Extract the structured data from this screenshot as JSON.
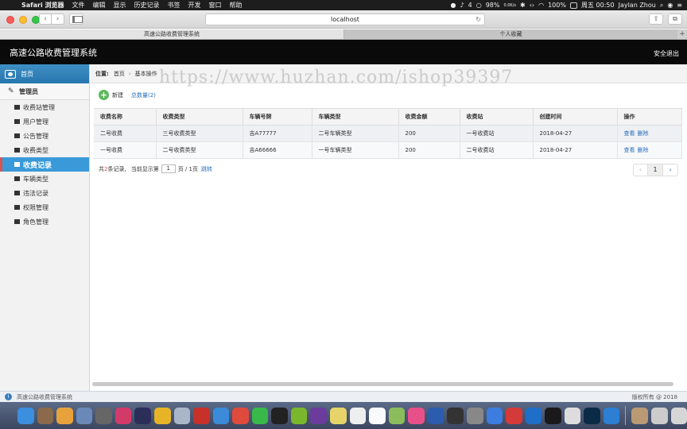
{
  "menubar": {
    "app_name": "Safari 浏览器",
    "items": [
      "文件",
      "编辑",
      "显示",
      "历史记录",
      "书签",
      "开发",
      "窗口",
      "帮助"
    ],
    "battery": "98%",
    "battery_full": "100%",
    "notif_count": "4",
    "net_up": "0.0K/s",
    "net_down": "0.0K/s",
    "clock": "周五 00:50",
    "user": "Jaylan Zhou"
  },
  "browser": {
    "url": "localhost",
    "tabs": [
      "高速公路收费管理系统",
      "个人收藏"
    ]
  },
  "app": {
    "title": "高速公路收费管理系统",
    "logout": "安全退出"
  },
  "sidebar": {
    "home": "首页",
    "group": "管理员",
    "items": [
      {
        "label": "收费站管理"
      },
      {
        "label": "用户管理"
      },
      {
        "label": "公告管理"
      },
      {
        "label": "收费类型"
      },
      {
        "label": "收费记录"
      },
      {
        "label": "车辆类型"
      },
      {
        "label": "违法记录"
      },
      {
        "label": "权限管理"
      },
      {
        "label": "角色管理"
      }
    ],
    "active_index": 4
  },
  "breadcrumb": {
    "label": "位置:",
    "home": "首页",
    "current": "基本操作"
  },
  "watermark": "https://www.huzhan.com/ishop39397",
  "toolbar": {
    "new_label": "新建",
    "count_label": "总数量(2)"
  },
  "table": {
    "headers": [
      "收费名称",
      "收费类型",
      "车辆号牌",
      "车辆类型",
      "收费金额",
      "收费站",
      "创建时间",
      "操作"
    ],
    "rows": [
      [
        "二号收费",
        "三号收费类型",
        "吉A77777",
        "二号车辆类型",
        "200",
        "一号收费站",
        "2018-04-27"
      ],
      [
        "一号收费",
        "二号收费类型",
        "吉A66666",
        "一号车辆类型",
        "200",
        "二号收费站",
        "2018-04-27"
      ]
    ],
    "op_view": "查看",
    "op_delete": "删除"
  },
  "pagination": {
    "prefix": "共",
    "total": "2",
    "suffix": "条记录,",
    "current_prefix": "当前显示第",
    "current_page": "1",
    "page_of": "页 / 1页",
    "jump": "跳转",
    "prev": "‹",
    "page1": "1",
    "next": "›"
  },
  "statusbar": {
    "left": "高速公路收费管理系统",
    "right": "版权所有 @ 2018"
  },
  "colors": {
    "header_bg": "#0a0a0a",
    "sidebar_active": "#3a9ad9",
    "link": "#2a6ebb",
    "add_green": "#5cb85c"
  }
}
